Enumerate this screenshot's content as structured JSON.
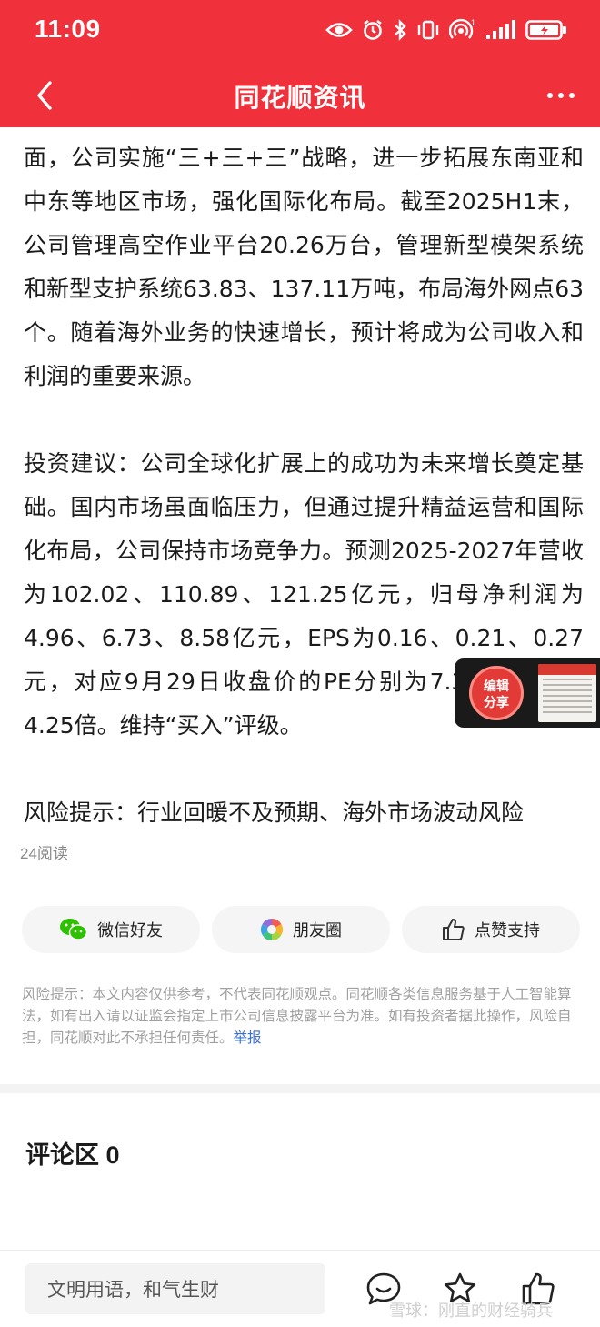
{
  "status_bar": {
    "time": "11:09",
    "icons": [
      "eye-icon",
      "alarm-icon",
      "bluetooth-icon",
      "vibrate-icon",
      "hotspot-icon",
      "signal-icon",
      "battery-charging-icon"
    ],
    "hotspot_sup": "1"
  },
  "nav": {
    "title": "同花顺资讯",
    "back_icon": "chevron-left-icon",
    "more_icon": "more-horizontal-icon"
  },
  "article": {
    "paragraphs": [
      "面，公司实施“三+三+三”战略，进一步拓展东南亚和中东等地区市场，强化国际化布局。截至2025H1末，公司管理高空作业平台20.26万台，管理新型模架系统和新型支护系统63.83、137.11万吨，布局海外网点63个。随着海外业务的快速增长，预计将成为公司收入和利润的重要来源。",
      "投资建议：公司全球化扩展上的成功为未来增长奠定基础。国内市场虽面临压力，但通过提升精益运营和国际化布局，公司保持市场竞争力。预测2025-2027年营收为102.02、110.89、121.25亿元，归母净利润为4.96、6.73、8.58亿元，EPS为0.16、0.21、0.27元，对应9月29日收盘价的PE分别为7.36、5.43、4.25倍。维持“买入”评级。",
      "风险提示：行业回暖不及预期、海外市场波动风险"
    ]
  },
  "float_share": {
    "line1": "编辑",
    "line2": "分享"
  },
  "read_count": "24阅读",
  "share": {
    "wechat": "微信好友",
    "moments": "朋友圈",
    "like": "点赞支持"
  },
  "disclaimer": {
    "text": "风险提示：本文内容仅供参考，不代表同花顺观点。同花顺各类信息服务基于人工智能算法，如有出入请以证监会指定上市公司信息披露平台为准。如有投资者据此操作，风险自担，同花顺对此不承担任何责任。",
    "report_link": "举报"
  },
  "comments": {
    "title": "评论区 0"
  },
  "bottom_bar": {
    "input_placeholder": "文明用语，和气生财",
    "icons": [
      "comment-icon",
      "star-icon",
      "thumbs-up-icon"
    ],
    "watermark": "雪球：刚直的财经骑兵"
  },
  "colors": {
    "brand_red": "#f0303a",
    "link_blue": "#3a6fd8",
    "wechat_green": "#2dc100"
  }
}
